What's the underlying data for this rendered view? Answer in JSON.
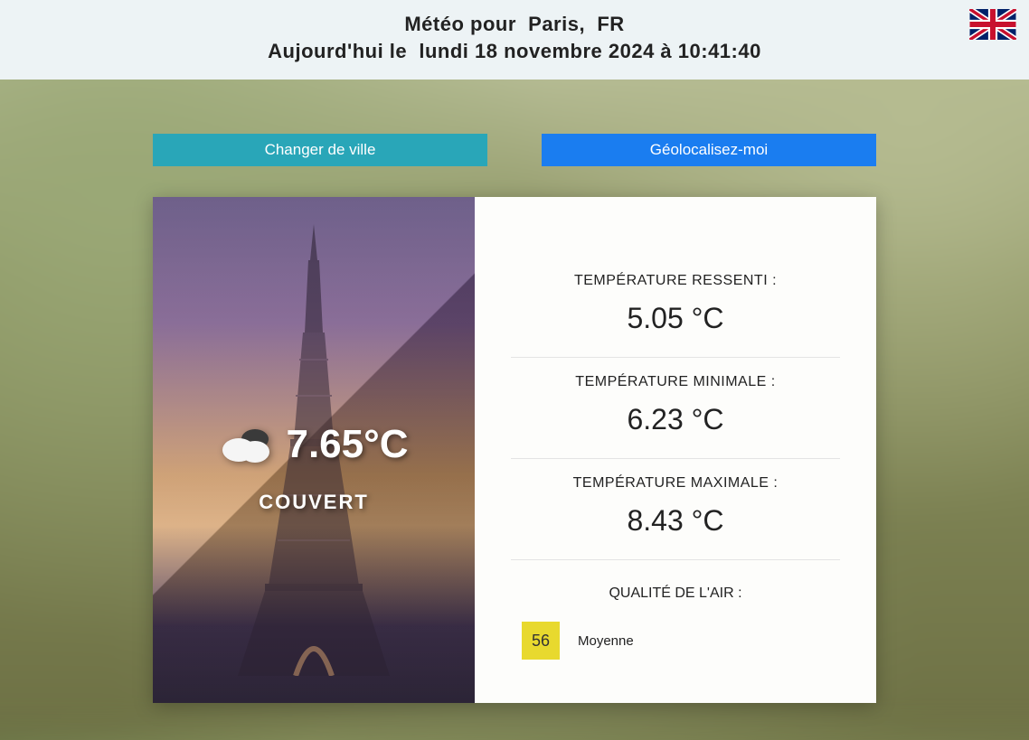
{
  "header": {
    "title_prefix": "Météo pour",
    "city": "Paris,",
    "country": "FR",
    "date_prefix": "Aujourd'hui le",
    "date": "lundi 18 novembre 2024 à 10:41:40"
  },
  "buttons": {
    "change_city": "Changer de ville",
    "geolocate": "Géolocalisez-moi"
  },
  "current": {
    "temp": "7.65°C",
    "condition": "COUVERT"
  },
  "metrics": {
    "feels_label": "TEMPÉRATURE RESSENTI :",
    "feels_value": "5.05 °C",
    "min_label": "TEMPÉRATURE MINIMALE :",
    "min_value": "6.23 °C",
    "max_label": "TEMPÉRATURE MAXIMALE :",
    "max_value": "8.43 °C"
  },
  "air": {
    "label": "QUALITÉ DE L'AIR :",
    "index": "56",
    "quality": "Moyenne"
  }
}
